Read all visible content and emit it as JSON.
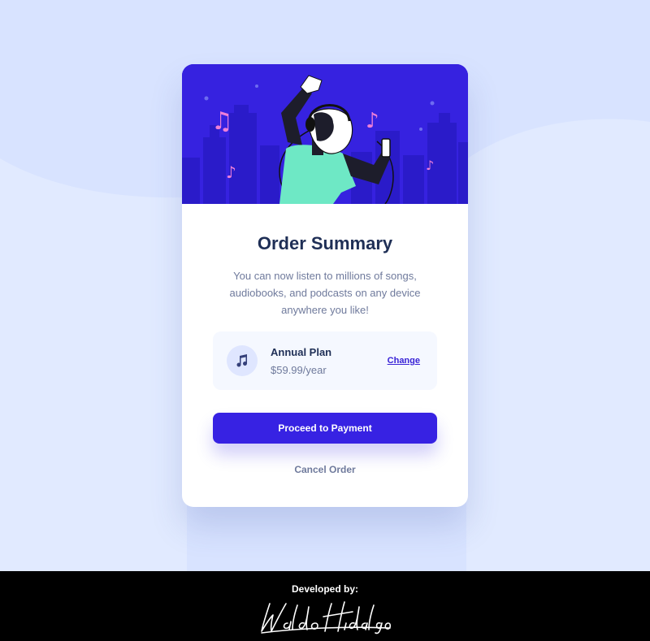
{
  "card": {
    "title": "Order Summary",
    "description": "You can now listen to millions of songs, audiobooks, and podcasts on any device anywhere you like!"
  },
  "plan": {
    "icon": "music-note-icon",
    "name": "Annual Plan",
    "price": "$59.99/year",
    "change_label": "Change"
  },
  "actions": {
    "proceed_label": "Proceed to Payment",
    "cancel_label": "Cancel Order"
  },
  "footer": {
    "developed_by_label": "Developed by:",
    "signature": "Waldo Hidalgo"
  },
  "colors": {
    "background": "#d8e3ff",
    "hero": "#3622e0",
    "primary": "#3722e3",
    "title": "#1f2f56",
    "muted": "#6f7a9c",
    "plan_bg": "#f5f8ff"
  }
}
